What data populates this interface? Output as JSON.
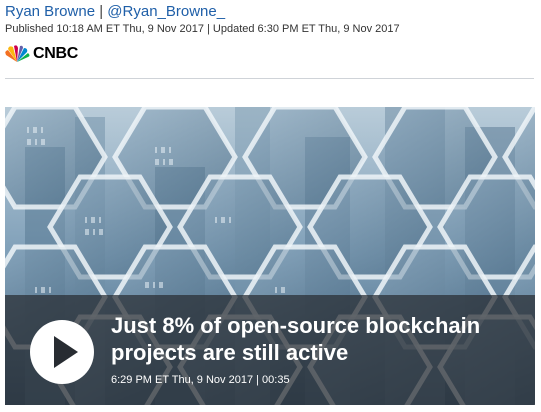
{
  "author": {
    "name": "Ryan Browne",
    "separator": "|",
    "handle": "@Ryan_Browne_"
  },
  "timestamp": "Published 10:18 AM ET Thu, 9 Nov 2017 | Updated 6:30 PM ET Thu, 9 Nov 2017",
  "source_logo": {
    "text": "CNBC",
    "icon": "peacock-icon"
  },
  "video": {
    "title": "Just 8% of open-source blockchain projects are still active",
    "meta": "6:29 PM ET Thu, 9 Nov 2017 | 00:35",
    "play_icon": "play-icon"
  },
  "colors": {
    "link": "#1f5fa8",
    "caption_overlay": "#282c32",
    "divider": "#cfd3d8"
  }
}
